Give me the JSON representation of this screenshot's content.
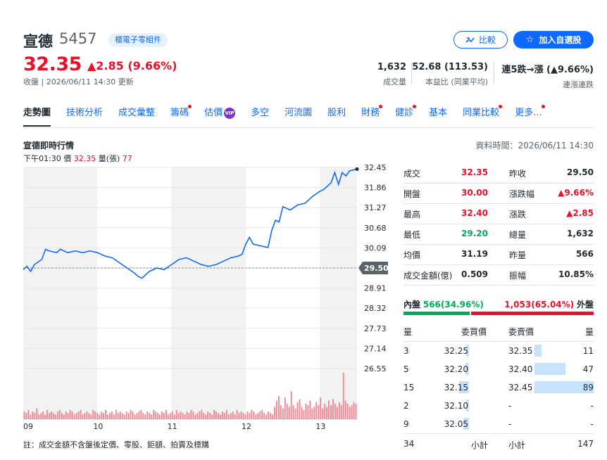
{
  "stock": {
    "name": "宣德",
    "code": "5457",
    "category": "櫃電子零組件",
    "price": "32.35",
    "change": "▲2.85 (9.66%)",
    "close_info": "收盤 | 2026/06/11 14:30 更新"
  },
  "buttons": {
    "compare": "比較",
    "add_watchlist": "加入自選股"
  },
  "stats": [
    {
      "value": "1,632",
      "label": "成交量"
    },
    {
      "value": "52.68 (113.53)",
      "label": "本益比 (同業平均)"
    },
    {
      "value": "連5跌→漲 (▲9.66%)",
      "label": "連漲連跌"
    }
  ],
  "nav": [
    {
      "label": "走勢圖",
      "active": true,
      "dot": false
    },
    {
      "label": "技術分析",
      "dot": false
    },
    {
      "label": "成交彙整",
      "dot": false
    },
    {
      "label": "籌碼",
      "dot": true
    },
    {
      "label": "估價",
      "dot": false,
      "vip": true
    },
    {
      "label": "多空",
      "dot": false
    },
    {
      "label": "河流圖",
      "dot": false
    },
    {
      "label": "股利",
      "dot": false
    },
    {
      "label": "財務",
      "dot": true
    },
    {
      "label": "健診",
      "dot": true
    },
    {
      "label": "基本",
      "dot": false
    },
    {
      "label": "同業比較",
      "dot": true
    },
    {
      "label": "更多...",
      "dot": true
    }
  ],
  "vip_label": "VIP",
  "chart_header": {
    "title": "宣德即時行情",
    "data_time": "資料時間：2026/06/11 14:30",
    "tick_time": "下午01:30",
    "tick_price_label": "價",
    "tick_price": "32.35",
    "tick_volume_label": "量(張)",
    "tick_volume": "77"
  },
  "note": "註：成交金額不含盤後定價、零股、鉅額、拍賣及標購",
  "chart_data": {
    "type": "line",
    "y_ticks": [
      "32.45",
      "31.86",
      "31.27",
      "30.68",
      "30.09",
      "29.50",
      "28.91",
      "28.32",
      "27.73",
      "27.14",
      "26.55"
    ],
    "x_ticks": [
      "09",
      "10",
      "11",
      "12",
      "13"
    ],
    "reference_price": 29.5,
    "ylim": [
      26.55,
      32.45
    ],
    "series": [
      {
        "values": [
          [
            9.0,
            29.45
          ],
          [
            9.05,
            29.55
          ],
          [
            9.1,
            29.4
          ],
          [
            9.15,
            29.6
          ],
          [
            9.25,
            29.75
          ],
          [
            9.3,
            30.05
          ],
          [
            9.35,
            30.0
          ],
          [
            9.45,
            29.95
          ],
          [
            9.5,
            30.05
          ],
          [
            9.6,
            29.95
          ],
          [
            9.7,
            30.0
          ],
          [
            9.8,
            29.95
          ],
          [
            9.9,
            30.0
          ],
          [
            10.0,
            29.95
          ],
          [
            10.1,
            29.85
          ],
          [
            10.2,
            29.8
          ],
          [
            10.3,
            29.65
          ],
          [
            10.4,
            29.5
          ],
          [
            10.5,
            29.35
          ],
          [
            10.55,
            29.25
          ],
          [
            10.6,
            29.2
          ],
          [
            10.7,
            29.4
          ],
          [
            10.8,
            29.5
          ],
          [
            10.9,
            29.45
          ],
          [
            11.0,
            29.6
          ],
          [
            11.1,
            29.75
          ],
          [
            11.2,
            29.8
          ],
          [
            11.3,
            29.7
          ],
          [
            11.4,
            29.6
          ],
          [
            11.5,
            29.55
          ],
          [
            11.6,
            29.6
          ],
          [
            11.7,
            29.7
          ],
          [
            11.8,
            29.8
          ],
          [
            11.9,
            29.85
          ],
          [
            11.95,
            29.9
          ],
          [
            12.0,
            30.2
          ],
          [
            12.05,
            30.4
          ],
          [
            12.1,
            30.2
          ],
          [
            12.2,
            30.15
          ],
          [
            12.3,
            30.1
          ],
          [
            12.35,
            30.6
          ],
          [
            12.4,
            30.9
          ],
          [
            12.45,
            30.85
          ],
          [
            12.5,
            31.3
          ],
          [
            12.55,
            31.25
          ],
          [
            12.6,
            31.2
          ],
          [
            12.7,
            31.35
          ],
          [
            12.8,
            31.4
          ],
          [
            12.9,
            31.6
          ],
          [
            13.0,
            31.75
          ],
          [
            13.05,
            31.8
          ],
          [
            13.1,
            31.9
          ],
          [
            13.15,
            32.0
          ],
          [
            13.2,
            32.3
          ],
          [
            13.25,
            31.95
          ],
          [
            13.3,
            32.3
          ],
          [
            13.35,
            32.2
          ],
          [
            13.4,
            32.35
          ],
          [
            13.5,
            32.4
          ]
        ]
      }
    ],
    "volume": [
      5,
      4,
      6,
      3,
      5,
      4,
      7,
      3,
      4,
      5,
      3,
      6,
      4,
      5,
      4,
      3,
      5,
      6,
      4,
      3,
      5,
      4,
      6,
      5,
      3,
      4,
      5,
      6,
      3,
      4,
      5,
      4,
      3,
      6,
      5,
      4,
      3,
      5,
      4,
      6,
      3,
      4,
      5,
      3,
      6,
      4,
      5,
      4,
      3,
      5,
      4,
      6,
      5,
      3,
      4,
      5,
      6,
      4,
      3,
      5,
      4,
      3,
      6,
      5,
      4,
      3,
      5,
      4,
      6,
      3,
      4,
      5,
      3,
      6,
      4,
      5,
      4,
      3,
      5,
      4,
      6,
      5,
      3,
      4,
      5,
      6,
      4,
      3,
      5,
      4,
      3,
      6,
      5,
      4,
      3,
      5,
      4,
      6,
      3,
      4,
      5,
      3,
      6,
      4,
      5,
      4,
      3,
      5,
      4,
      6,
      5,
      3,
      4,
      5,
      6,
      4,
      3,
      5,
      4,
      3,
      8,
      12,
      15,
      9,
      7,
      14,
      10,
      8,
      18,
      9,
      7,
      11,
      13,
      8,
      6,
      10,
      9,
      12,
      7,
      8,
      11,
      9,
      14,
      7,
      10,
      8,
      12,
      9,
      13,
      10,
      8,
      11,
      9,
      30,
      12,
      10,
      8,
      9,
      11,
      10
    ]
  },
  "quote": [
    {
      "l1": "成交",
      "v1": "32.35",
      "c1": "red",
      "l2": "昨收",
      "v2": "29.50",
      "c2": ""
    },
    {
      "l1": "開盤",
      "v1": "30.00",
      "c1": "red",
      "l2": "漲跌幅",
      "v2": "▲9.66%",
      "c2": "red"
    },
    {
      "l1": "最高",
      "v1": "32.40",
      "c1": "red",
      "l2": "漲跌",
      "v2": "▲2.85",
      "c2": "red"
    },
    {
      "l1": "最低",
      "v1": "29.20",
      "c1": "green",
      "l2": "總量",
      "v2": "1,632",
      "c2": ""
    },
    {
      "l1": "均價",
      "v1": "31.19",
      "c1": "",
      "l2": "昨量",
      "v2": "566",
      "c2": ""
    },
    {
      "l1": "成交金額(億)",
      "v1": "0.509",
      "c1": "",
      "l2": "振幅",
      "v2": "10.85%",
      "c2": ""
    }
  ],
  "inout": {
    "in_label": "內盤",
    "in_value": "566(34.96%)",
    "out_value": "1,053(65.04%)",
    "out_label": "外盤",
    "in_fraction": 0.3496
  },
  "book": {
    "headers": {
      "bid_qty": "量",
      "bid_price": "委買價",
      "ask_price": "委賣價",
      "ask_qty": "量"
    },
    "rows": [
      {
        "bq": "3",
        "bp": "32.25",
        "ap": "32.35",
        "aq": "11",
        "bw": 3,
        "aw": 11
      },
      {
        "bq": "5",
        "bp": "32.20",
        "ap": "32.40",
        "aq": "47",
        "bw": 5,
        "aw": 47
      },
      {
        "bq": "15",
        "bp": "32.15",
        "ap": "32.45",
        "aq": "89",
        "bw": 15,
        "aw": 89
      },
      {
        "bq": "2",
        "bp": "32.10",
        "ap": "-",
        "aq": "-",
        "bw": 2,
        "aw": 0
      },
      {
        "bq": "9",
        "bp": "32.05",
        "ap": "-",
        "aq": "-",
        "bw": 9,
        "aw": 0
      }
    ],
    "footer": {
      "bid_total": "34",
      "bid_label": "小計",
      "ask_label": "小計",
      "ask_total": "147"
    }
  },
  "colors": {
    "up": "#eb0f29",
    "down": "#00ab5e",
    "line": "#0f69ff",
    "accent": "#0f69ff"
  }
}
